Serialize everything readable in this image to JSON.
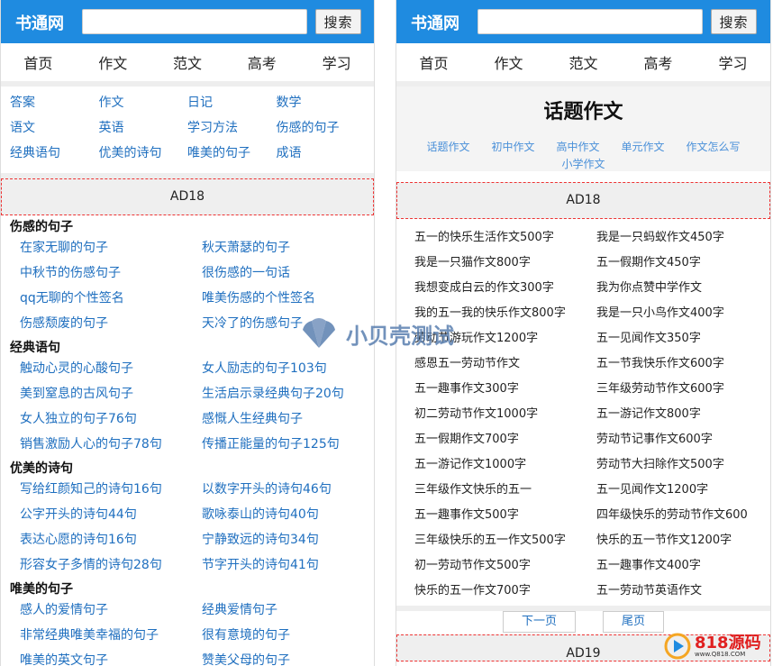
{
  "left": {
    "header": {
      "logo": "书通网",
      "search_placeholder": "",
      "search_button": "搜索"
    },
    "nav": [
      "首页",
      "作文",
      "范文",
      "高考",
      "学习"
    ],
    "categories": [
      "答案",
      "作文",
      "日记",
      "数学",
      "语文",
      "英语",
      "学习方法",
      "伤感的句子",
      "经典语句",
      "优美的诗句",
      "唯美的句子",
      "成语"
    ],
    "ad": "AD18",
    "sections": [
      {
        "title": "伤感的句子",
        "links": [
          "在家无聊的句子",
          "秋天萧瑟的句子",
          "中秋节的伤感句子",
          "很伤感的一句话",
          "qq无聊的个性签名",
          "唯美伤感的个性签名",
          "伤感颓废的句子",
          "天冷了的伤感句子"
        ]
      },
      {
        "title": "经典语句",
        "links": [
          "触动心灵的心酸句子",
          "女人励志的句子103句",
          "美到窒息的古风句子",
          "生活启示录经典句子20句",
          "女人独立的句子76句",
          "感慨人生经典句子",
          "销售激励人心的句子78句",
          "传播正能量的句子125句"
        ]
      },
      {
        "title": "优美的诗句",
        "links": [
          "写给红颜知己的诗句16句",
          "以数字开头的诗句46句",
          "公字开头的诗句44句",
          "歌咏泰山的诗句40句",
          "表达心愿的诗句16句",
          "宁静致远的诗句34句",
          "形容女子多情的诗句28句",
          "节字开头的诗句41句"
        ]
      },
      {
        "title": "唯美的句子",
        "links": [
          "感人的爱情句子",
          "经典爱情句子",
          "非常经典唯美幸福的句子",
          "很有意境的句子",
          "唯美的英文句子",
          "赞美父母的句子"
        ]
      }
    ]
  },
  "right": {
    "header": {
      "logo": "书通网",
      "search_placeholder": "",
      "search_button": "搜索"
    },
    "nav": [
      "首页",
      "作文",
      "范文",
      "高考",
      "学习"
    ],
    "topic": {
      "title": "话题作文",
      "subs": [
        "话题作文",
        "初中作文",
        "高中作文",
        "单元作文",
        "作文怎么写",
        "小学作文"
      ]
    },
    "ad": "AD18",
    "essays": [
      "五一的快乐生活作文500字",
      "我是一只蚂蚁作文450字",
      "我是一只猫作文800字",
      "五一假期作文450字",
      "我想变成白云的作文300字",
      "我为你点赞中学作文",
      "我的五一我的快乐作文800字",
      "我是一只小鸟作文400字",
      "劳动节游玩作文1200字",
      "五一见闻作文350字",
      "感恩五一劳动节作文",
      "五一节我快乐作文600字",
      "五一趣事作文300字",
      "三年级劳动节作文600字",
      "初二劳动节作文1000字",
      "五一游记作文800字",
      "五一假期作文700字",
      "劳动节记事作文600字",
      "五一游记作文1000字",
      "劳动节大扫除作文500字",
      "三年级作文快乐的五一",
      "五一见闻作文1200字",
      "五一趣事作文500字",
      "四年级快乐的劳动节作文600",
      "三年级快乐的五一作文500字",
      "快乐的五一节作文1200字",
      "初一劳动节作文500字",
      "五一趣事作文400字",
      "快乐的五一作文700字",
      "五一劳动节英语作文"
    ],
    "pager": {
      "next": "下一页",
      "last": "尾页"
    },
    "ad2": "AD19"
  },
  "watermark": {
    "text": "小贝壳测试"
  },
  "corner_logo": {
    "main": "818源码",
    "url": "www.Q818.COM"
  },
  "colors": {
    "header_bg": "#1f8be0",
    "link": "#1f6fbf",
    "ad_border": "#e33333",
    "brand_red": "#e02020"
  }
}
